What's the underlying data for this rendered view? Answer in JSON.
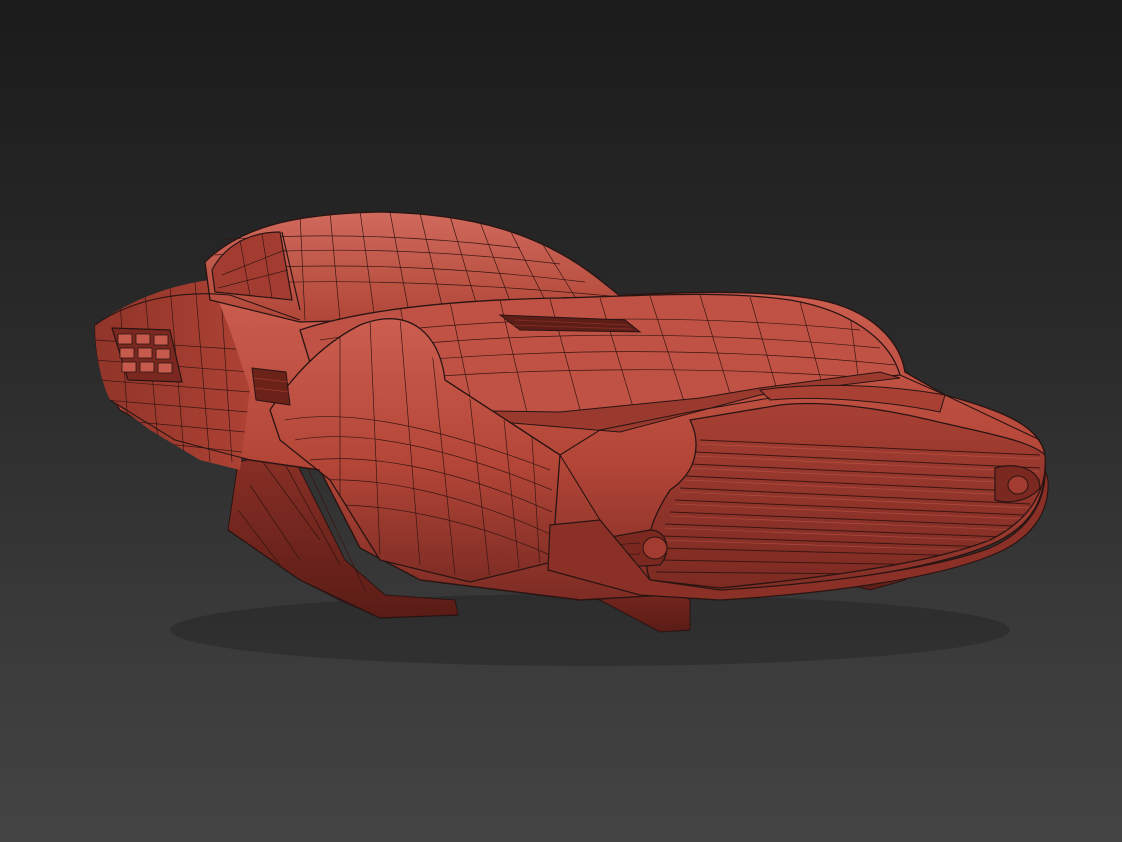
{
  "viewport": {
    "background_top": "#1b1b1b",
    "background_bottom": "#444444"
  },
  "model": {
    "subject": "hover-car",
    "display_mode": "wireframe-on-shaded",
    "surface_color": "#b84a3c",
    "surface_shadow": "#7a2a22",
    "surface_highlight": "#d2685a",
    "wire_color": "#2a1412"
  }
}
